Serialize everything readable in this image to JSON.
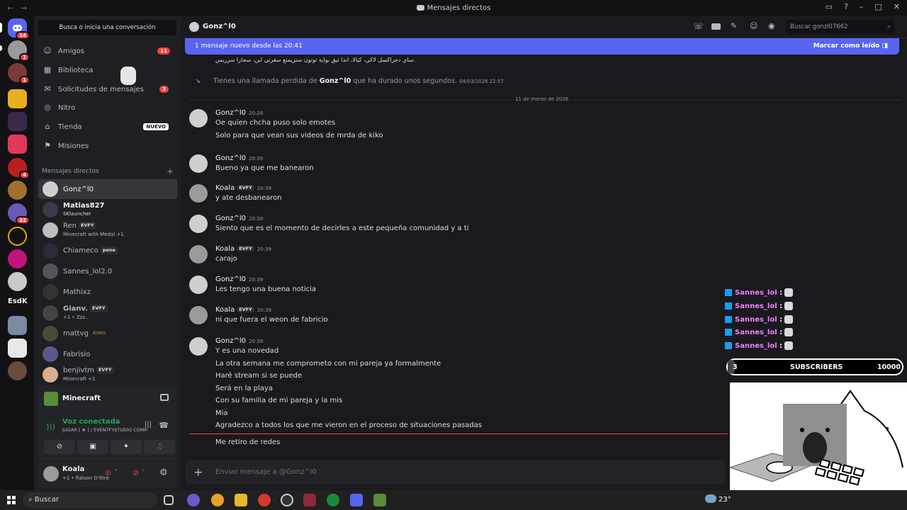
{
  "window": {
    "title": "Mensajes directos"
  },
  "servers": {
    "discord_badge": "14",
    "badges": [
      "1",
      "1",
      "4",
      "22"
    ],
    "esdk_label": "EsdK"
  },
  "sidebar": {
    "search_label": "Busca o inicia una conversación",
    "nav": [
      {
        "label": "Amigos",
        "badge": "11",
        "icon": "friends-icon"
      },
      {
        "label": "Biblioteca",
        "icon": "library-icon"
      },
      {
        "label": "Solicitudes de mensajes",
        "badge": "3",
        "icon": "inbox-icon"
      },
      {
        "label": "Nitro",
        "icon": "nitro-icon"
      },
      {
        "label": "Tienda",
        "badge_text": "NUEVO",
        "icon": "shop-icon"
      },
      {
        "label": "Misiones",
        "icon": "quests-icon"
      }
    ],
    "dm_header": "Mensajes directos",
    "dms": [
      {
        "name": "Gonz^l0",
        "sub": ""
      },
      {
        "name": "Matias827",
        "sub": "SKlauncher"
      },
      {
        "name": "Ren",
        "tag": "EVFY",
        "sub": "Minecraft with Medal +1"
      },
      {
        "name": "Chiameco",
        "tag": "pene",
        "sub": ""
      },
      {
        "name": "Sannes_lol2.0",
        "sub": ""
      },
      {
        "name": "Mathixz",
        "sub": ""
      },
      {
        "name": "Gianv.",
        "tag": "EVFY",
        "sub": "+1 • Zzz.."
      },
      {
        "name": "mattvg",
        "tag": "KING",
        "sub": ""
      },
      {
        "name": "Fabrisio",
        "sub": ""
      },
      {
        "name": "benjivtm",
        "tag": "EVFY",
        "sub": "Minecraft +1"
      }
    ]
  },
  "voice": {
    "game": "Minecraft",
    "status": "Voz conectada",
    "channel": "JUGAR [ ★ ] / EVENTFYSTUDIO COMMU..."
  },
  "user": {
    "name": "Koala",
    "status": "+1 • Raison D'être"
  },
  "chat": {
    "channel_name": "Gonz^l0",
    "search_placeholder": "Buscar gonzl07662",
    "banner_text": "1 mensaje nuevo desde las 20:41",
    "banner_action": "Marcar como leído",
    "top_line": "ساي دجراكسل لاكي، كيالا، اندا ثيق بواپه توتون ستريمنغ سقرثي اين، سجارا سرريس.",
    "missed_call": {
      "prefix": "Tienes una llamada perdida de ",
      "name": "Gonz^l0",
      "suffix": " que ha durado unos segundos.",
      "time": "04/03/2026 22:57"
    },
    "date_divider": "11 de marzo de 2026",
    "messages": [
      {
        "author": "Gonz^l0",
        "time": "20:28",
        "lines": [
          "Oe quien chcha puso solo emotes",
          "Solo para que vean sus videos de mrda de kiko"
        ]
      },
      {
        "author": "Gonz^l0",
        "time": "20:39",
        "lines": [
          "Bueno ya que me banearon"
        ]
      },
      {
        "author": "Koala",
        "tag": "EVFY",
        "time": "20:39",
        "lines": [
          "y ate desbanearon"
        ]
      },
      {
        "author": "Gonz^l0",
        "time": "20:39",
        "lines": [
          "Siento que es el momento de decirles a este pequeña comunidad y a ti"
        ]
      },
      {
        "author": "Koala",
        "tag": "EVFY",
        "time": "20:39",
        "lines": [
          "carajo"
        ]
      },
      {
        "author": "Gonz^l0",
        "time": "20:39",
        "lines": [
          "Les tengo una buena noticia"
        ]
      },
      {
        "author": "Koala",
        "tag": "EVFY",
        "time": "20:39",
        "lines": [
          "ni que fuera el weon de fabricio"
        ]
      },
      {
        "author": "Gonz^l0",
        "time": "20:39",
        "lines": [
          "Y es una novedad",
          "La otra semana me comprometo con mi pareja ya formalmente",
          "Haré stream si se puede",
          "Será en la playa",
          "Con su familia de mi pareja y la mis",
          "Mia",
          "Agradezco a todos los que me vieron en el proceso de situaciones pasadas"
        ]
      }
    ],
    "new_message": "Me retiro de redes",
    "composer_placeholder": "Enviar mensaje a @Gonz^l0"
  },
  "overlay": {
    "chat_lines": [
      "Sannes_lol",
      "Sannes_lol",
      "Sannes_lol",
      "Sannes_lol",
      "Sannes_lol"
    ],
    "subs_current": "3",
    "subs_label": "SUBSCRIBERS",
    "subs_goal": "10000",
    "subs_progress_fraction": 0.0003
  },
  "taskbar": {
    "search_label": "Buscar",
    "temp": "23°"
  }
}
